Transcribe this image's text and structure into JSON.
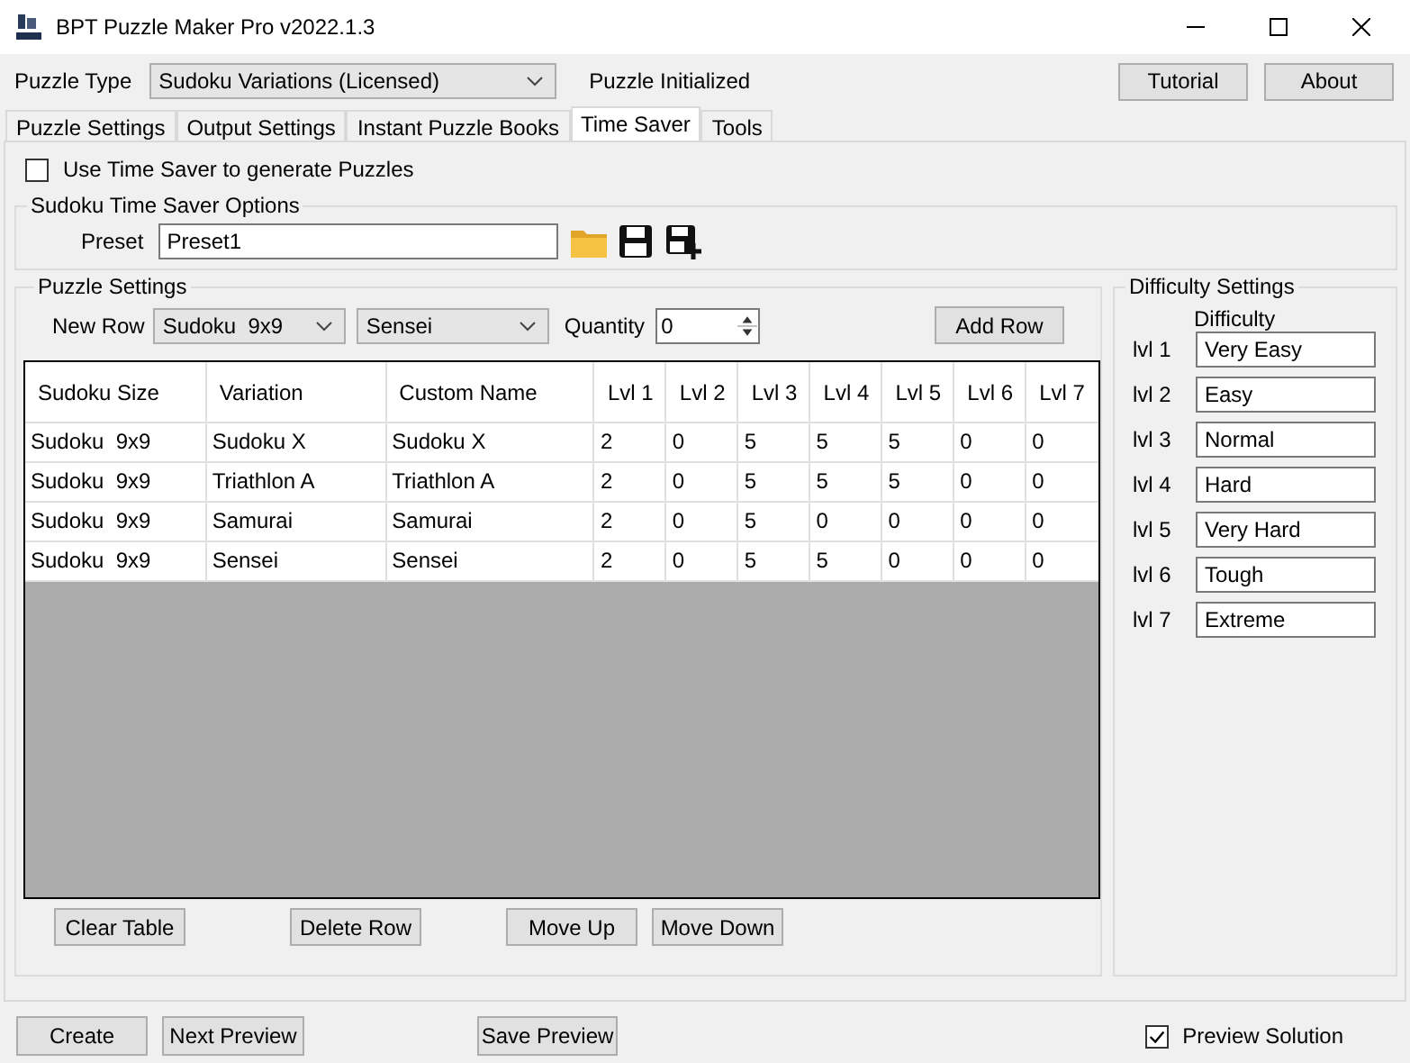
{
  "window": {
    "title": "BPT Puzzle Maker Pro v2022.1.3"
  },
  "puzzle_type": {
    "label": "Puzzle Type",
    "value": "Sudoku Variations (Licensed)"
  },
  "status": "Puzzle Initialized",
  "header_buttons": [
    "Tutorial",
    "About"
  ],
  "tabs": [
    {
      "label": "Puzzle Settings",
      "selected": false
    },
    {
      "label": "Output Settings",
      "selected": false
    },
    {
      "label": "Instant Puzzle Books",
      "selected": false
    },
    {
      "label": "Time Saver",
      "selected": true
    },
    {
      "label": "Tools",
      "selected": false
    }
  ],
  "use_time_saver": {
    "label": "Use Time Saver to generate Puzzles",
    "checked": false
  },
  "time_saver_options": {
    "title": "Sudoku Time Saver Options",
    "preset_label": "Preset",
    "preset_value": "Preset1"
  },
  "puzzle_settings": {
    "title": "Puzzle Settings",
    "new_row_label": "New Row",
    "size_value": "Sudoku  9x9",
    "variation_value": "Sensei",
    "quantity_label": "Quantity",
    "quantity_value": "0",
    "add_button": "Add Row"
  },
  "table": {
    "columns": [
      "Sudoku Size",
      "Variation",
      "Custom Name",
      "Lvl 1",
      "Lvl 2",
      "Lvl 3",
      "Lvl 4",
      "Lvl 5",
      "Lvl 6",
      "Lvl 7"
    ],
    "rows": [
      [
        "Sudoku  9x9",
        "Sudoku X",
        "Sudoku X",
        "2",
        "0",
        "5",
        "5",
        "5",
        "0",
        "0"
      ],
      [
        "Sudoku  9x9",
        "Triathlon A",
        "Triathlon A",
        "2",
        "0",
        "5",
        "5",
        "5",
        "0",
        "0"
      ],
      [
        "Sudoku  9x9",
        "Samurai",
        "Samurai",
        "2",
        "0",
        "5",
        "0",
        "0",
        "0",
        "0"
      ],
      [
        "Sudoku  9x9",
        "Sensei",
        "Sensei",
        "2",
        "0",
        "5",
        "5",
        "0",
        "0",
        "0"
      ]
    ]
  },
  "table_buttons": [
    "Clear Table",
    "Delete Row",
    "Move Up",
    "Move Down"
  ],
  "difficulty_settings": {
    "title": "Difficulty Settings",
    "column_header": "Difficulty",
    "levels": [
      {
        "label": "lvl 1",
        "value": "Very Easy"
      },
      {
        "label": "lvl 2",
        "value": "Easy"
      },
      {
        "label": "lvl 3",
        "value": "Normal"
      },
      {
        "label": "lvl 4",
        "value": "Hard"
      },
      {
        "label": "lvl 5",
        "value": "Very Hard"
      },
      {
        "label": "lvl 6",
        "value": "Tough"
      },
      {
        "label": "lvl 7",
        "value": "Extreme"
      }
    ]
  },
  "footer_buttons": [
    "Create",
    "Next Preview",
    "Save Preview"
  ],
  "preview_solution": {
    "label": "Preview Solution",
    "checked": true
  }
}
